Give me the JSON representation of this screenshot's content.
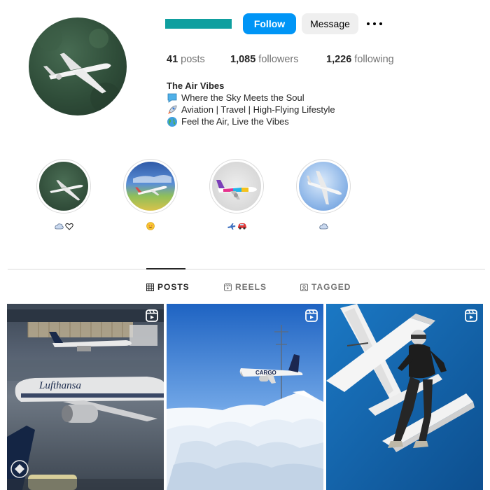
{
  "profile": {
    "follow_label": "Follow",
    "message_label": "Message",
    "username_color": "#0f9f9f",
    "accent_color": "#0095f6"
  },
  "stats": {
    "posts_value": "41",
    "posts_label": "posts",
    "followers_value": "1,085",
    "followers_label": "followers",
    "following_value": "1,226",
    "following_label": "following"
  },
  "bio": {
    "name": "The Air Vibes",
    "lines": [
      {
        "icon": "speech-bubble-icon",
        "text": "Where the Sky Meets the Soul"
      },
      {
        "icon": "rocket-icon",
        "text": "Aviation | Travel | High-Flying Lifestyle"
      },
      {
        "icon": "globe-icon",
        "text": "Feel the Air, Live the Vibes"
      }
    ]
  },
  "highlights": [
    {
      "icons": [
        "cloud-icon",
        "heart-outline-icon"
      ]
    },
    {
      "icons": [
        "star-struck-face-icon"
      ]
    },
    {
      "icons": [
        "airplane-icon",
        "red-car-icon"
      ]
    },
    {
      "icons": [
        "cloud-icon"
      ]
    }
  ],
  "tabs": {
    "posts": "POSTS",
    "reels": "REELS",
    "tagged": "TAGGED"
  },
  "posts": [
    {
      "type": "reel",
      "icon": "reel-icon",
      "caption_text": "Lufthansa"
    },
    {
      "type": "reel",
      "icon": "reel-icon",
      "caption_text": "CARGO"
    },
    {
      "type": "reel",
      "icon": "reel-icon",
      "caption_text": ""
    }
  ]
}
